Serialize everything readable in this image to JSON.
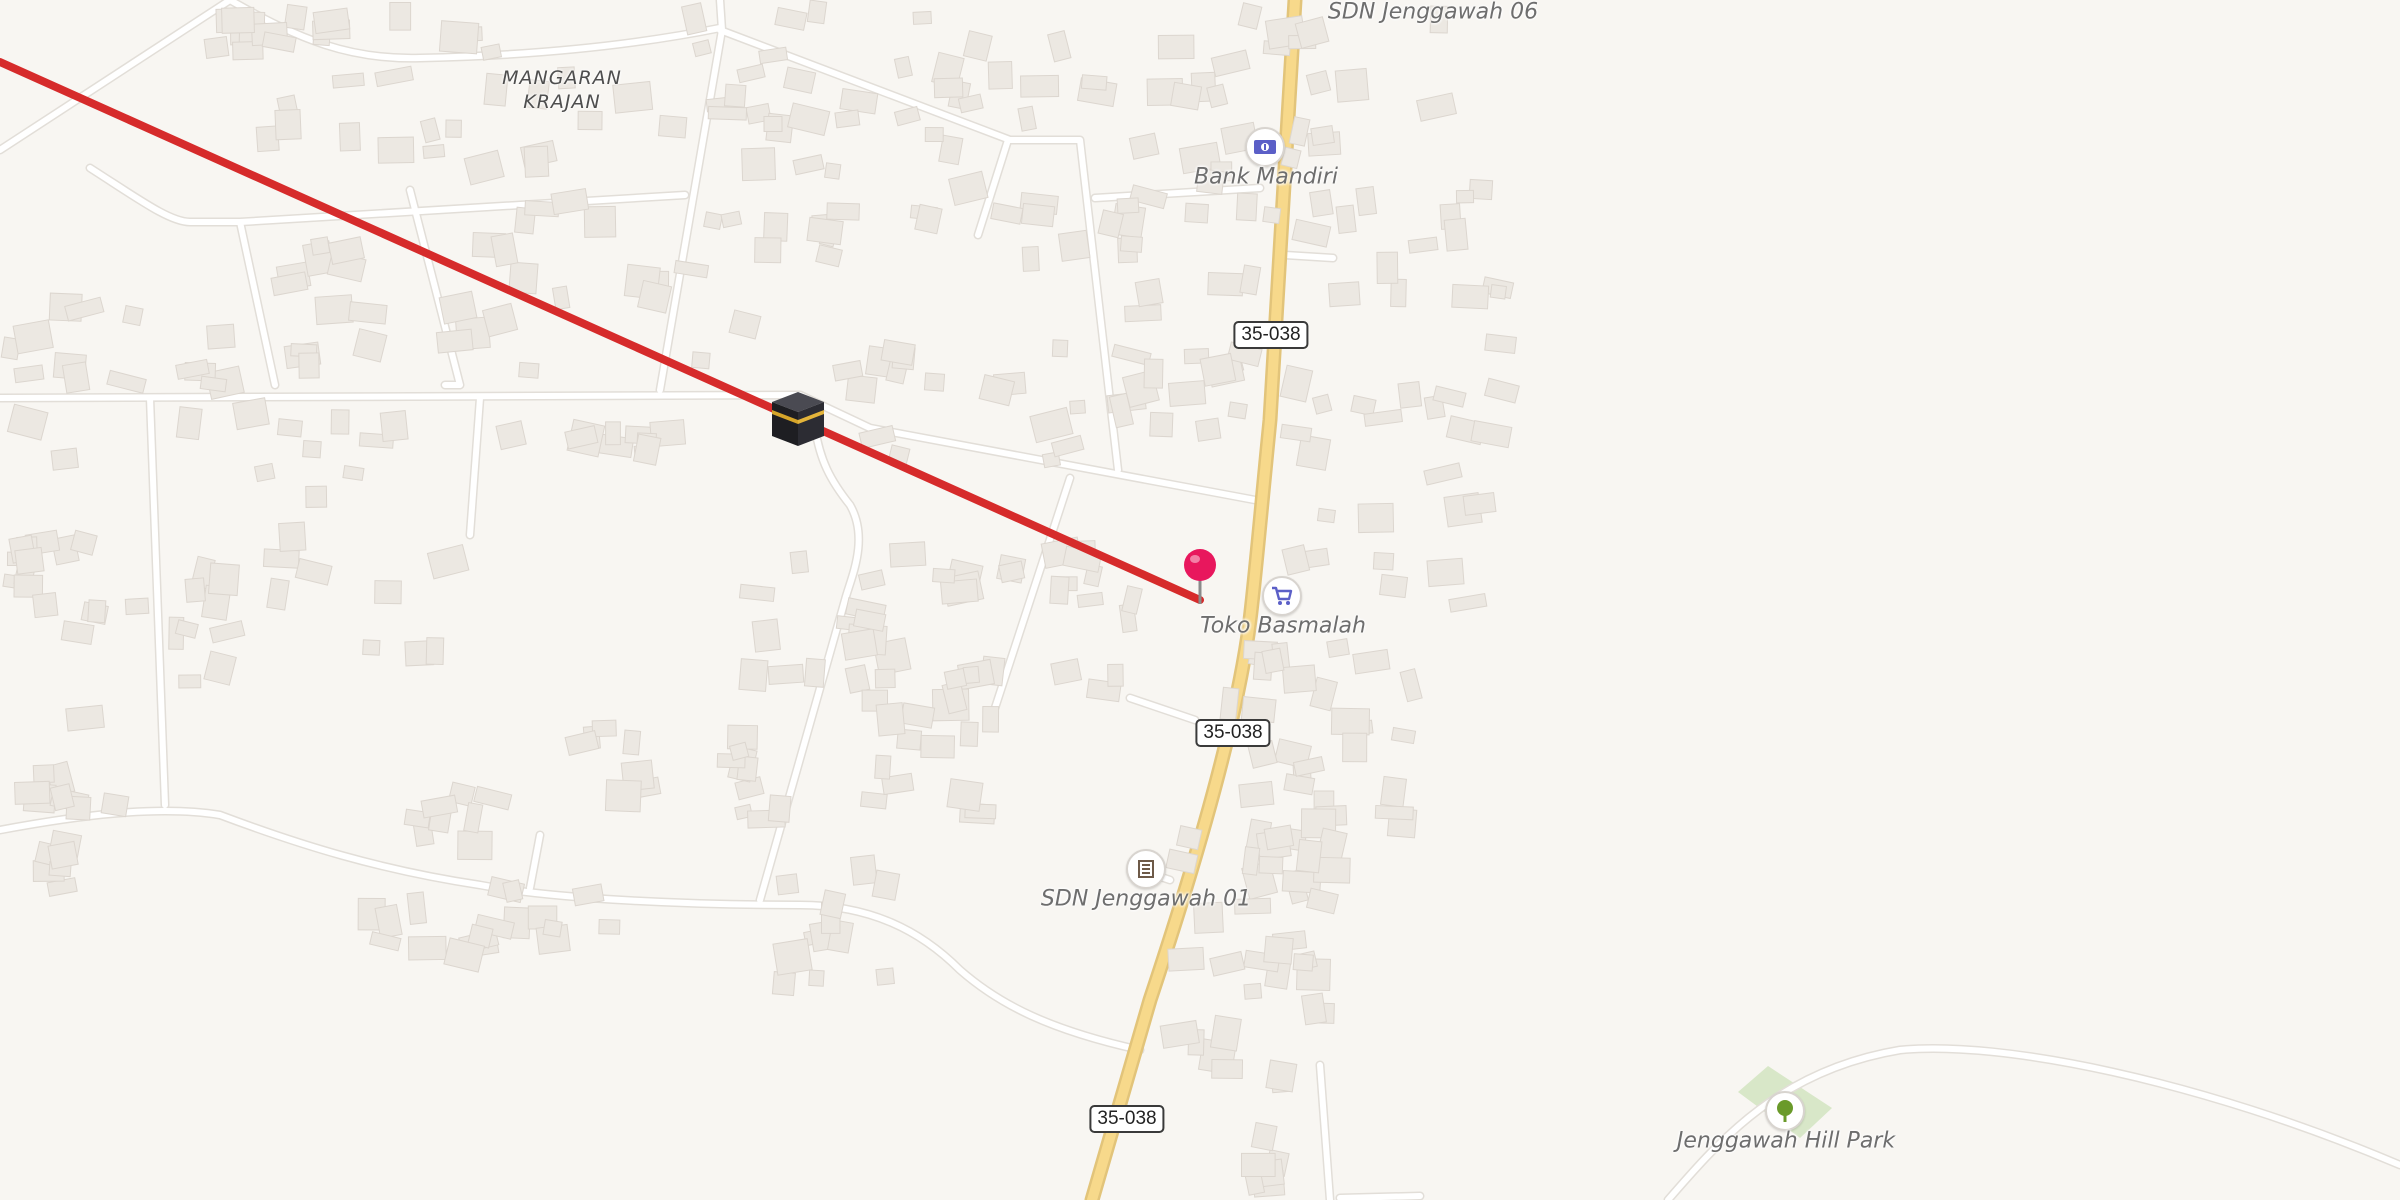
{
  "map": {
    "place_label": "MANGARAN\nKRAJAN",
    "route_number": "35-038",
    "pois": {
      "bank": {
        "name": "Bank Mandiri",
        "icon": "bank-icon"
      },
      "shop": {
        "name": "Toko Basmalah",
        "icon": "shopping-cart-icon"
      },
      "school_top": {
        "name": "SDN Jenggawah 06"
      },
      "school_bottom": {
        "name": "SDN Jenggawah 01",
        "icon": "school-icon"
      },
      "park": {
        "name": "Jenggawah Hill Park",
        "icon": "tree-icon"
      }
    },
    "markers": {
      "kaaba": {
        "icon": "kaaba-icon"
      },
      "pin": {
        "icon": "location-pin-icon",
        "color": "#e8175d"
      }
    },
    "qibla_line": {
      "color": "#d62b2b"
    },
    "colors": {
      "background": "#f8f6f2",
      "main_road": "#f7d98b",
      "poi_icon": "#5b5fc7",
      "park_icon": "#6a9a2a",
      "park_area": "#cfe3bd"
    }
  }
}
